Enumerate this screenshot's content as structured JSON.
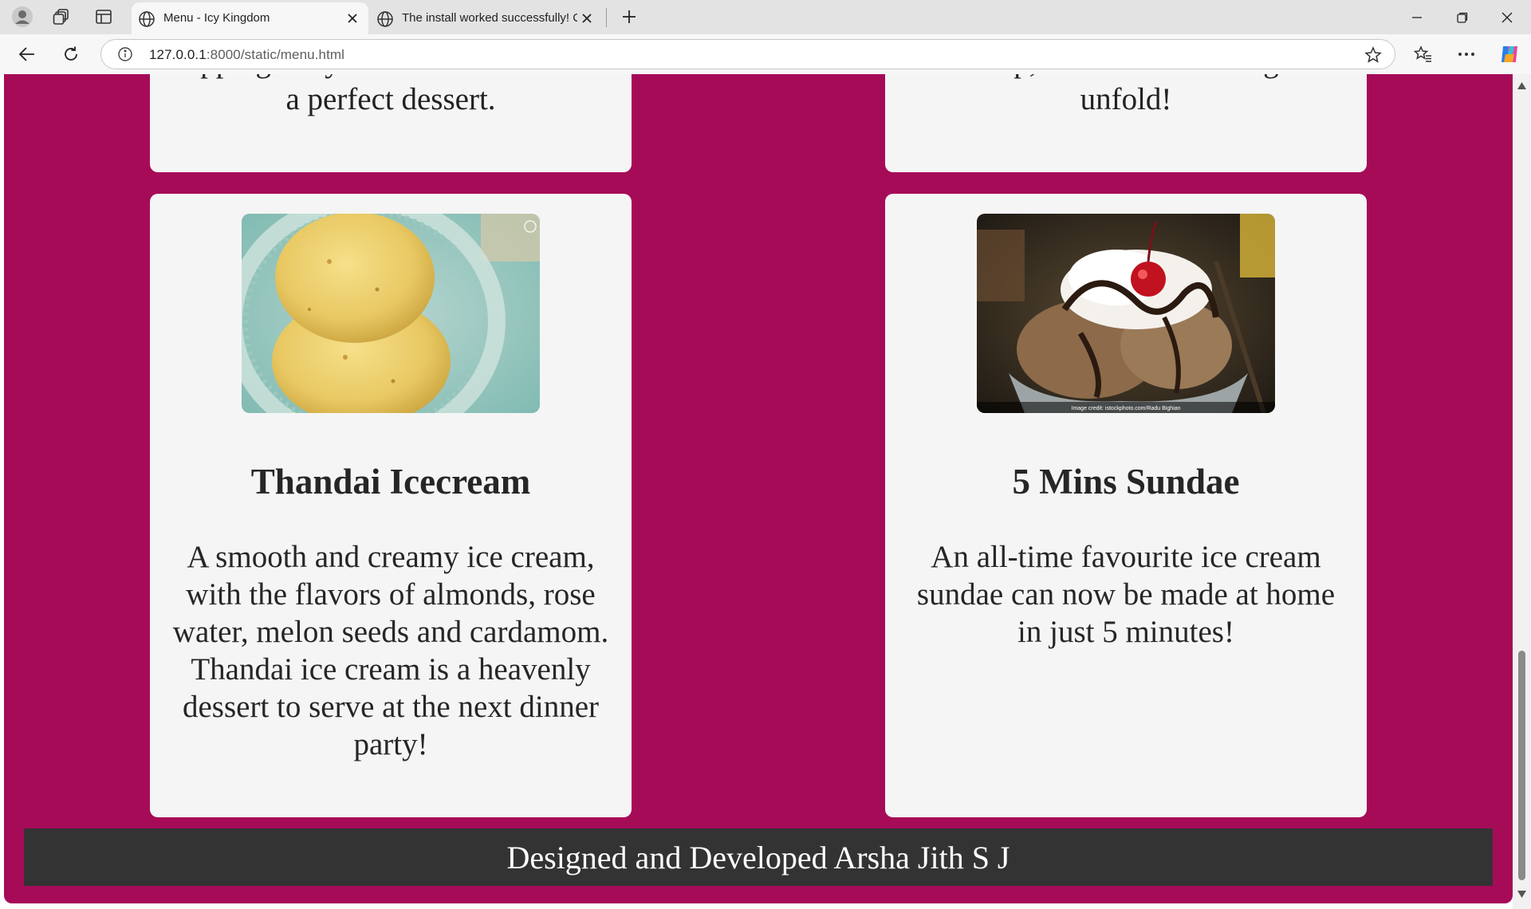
{
  "browser": {
    "tabs": [
      {
        "title": "Menu - Icy Kingdom",
        "active": true
      },
      {
        "title": "The install worked successfully! Co",
        "active": false
      }
    ],
    "url_host": "127.0.0.1",
    "url_path": ":8000/static/menu.html"
  },
  "menu": {
    "top_cards": [
      {
        "clipped_line": "toppings of your choice and create",
        "last_line": "a perfect dessert."
      },
      {
        "clipped_line": "on top, and watch the magic",
        "last_line": "unfold!"
      }
    ],
    "items": [
      {
        "name": "Thandai Icecream",
        "description": "A smooth and creamy ice cream, with the flavors of almonds, rose water, melon seeds and cardamom. Thandai ice cream is a heavenly dessert to serve at the next dinner party!",
        "image": "thandai-ice-cream-photo"
      },
      {
        "name": "5 Mins Sundae",
        "description": "An all-time favourite ice cream sundae can now be made at home in just 5 minutes!",
        "image": "chocolate-sundae-photo",
        "image_credit": "Image credit: istockphoto.com/Radu Bighian"
      }
    ]
  },
  "footer": {
    "text": "Designed and Developed Arsha Jith S J"
  },
  "colors": {
    "page_background": "#a60b58",
    "card_background": "#f5f5f5",
    "footer_background": "#333333"
  }
}
